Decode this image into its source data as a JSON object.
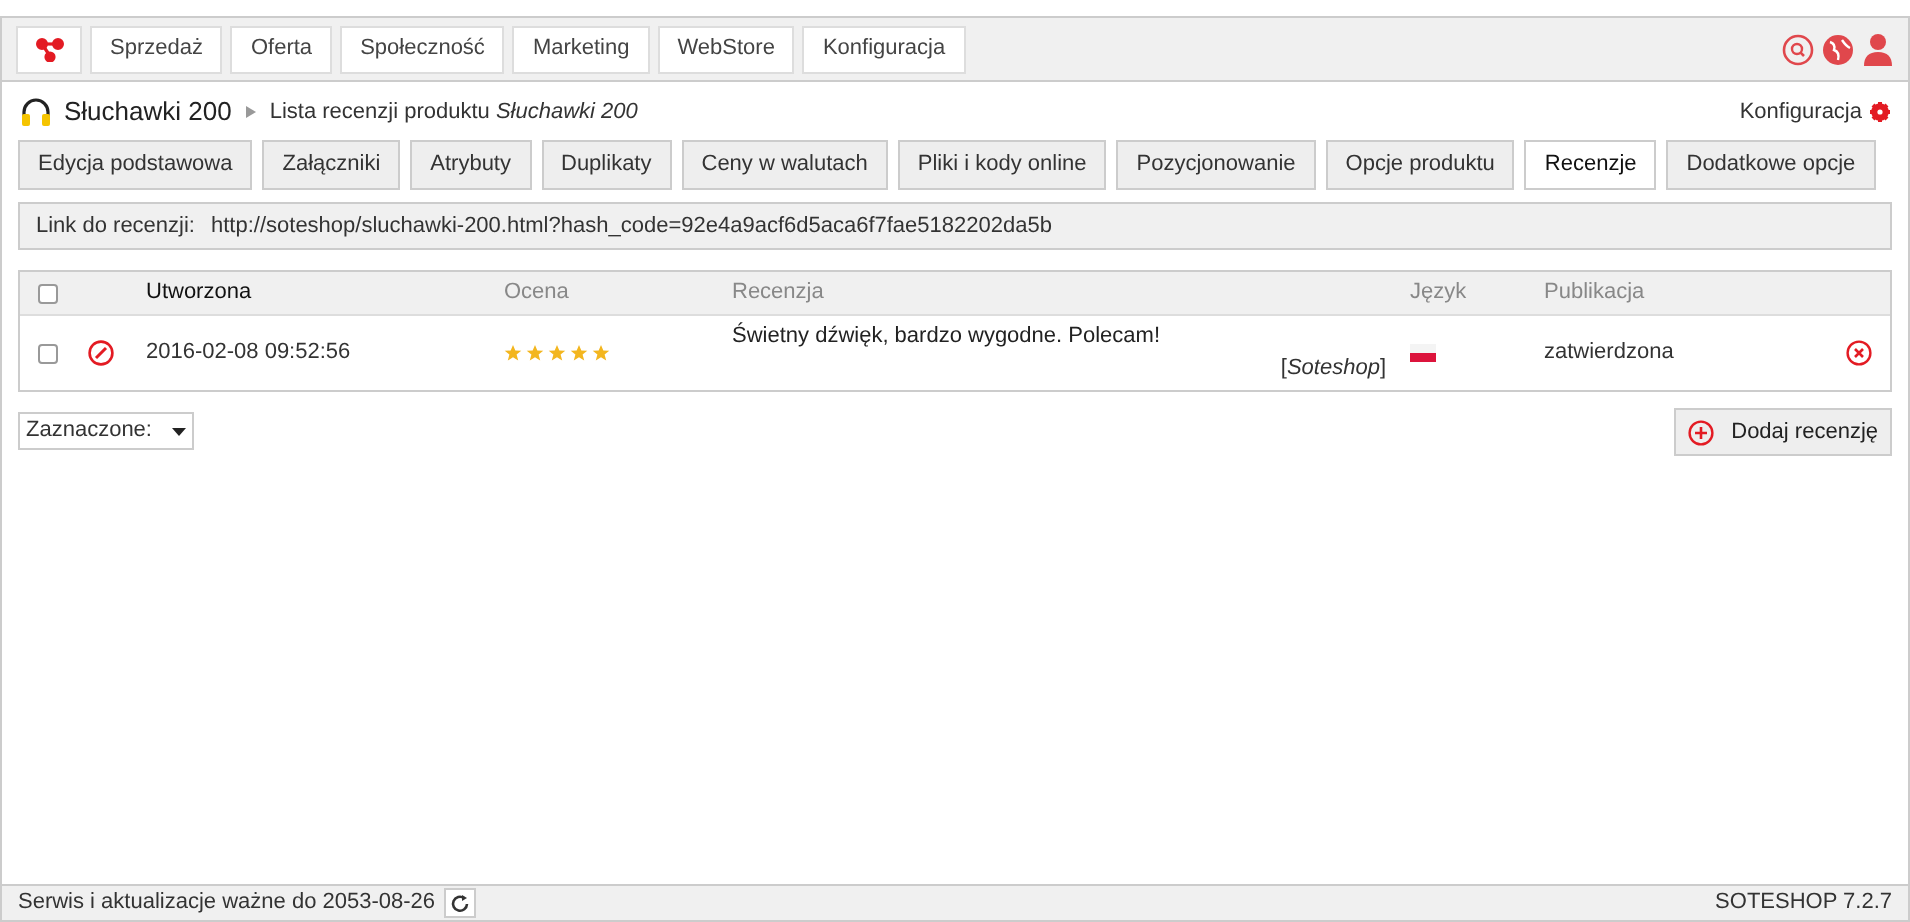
{
  "nav": [
    {
      "label": "Sprzedaż"
    },
    {
      "label": "Oferta"
    },
    {
      "label": "Społeczność"
    },
    {
      "label": "Marketing"
    },
    {
      "label": "WebStore"
    },
    {
      "label": "Konfiguracja"
    }
  ],
  "breadcrumb": {
    "product": "Słuchawki 200",
    "page": "Lista recenzji produktu *Słuchawki 200*"
  },
  "config_link": "Konfiguracja",
  "tabs": [
    {
      "label": "Edycja podstawowa",
      "selected": false
    },
    {
      "label": "Załączniki",
      "selected": false
    },
    {
      "label": "Atrybuty",
      "selected": false
    },
    {
      "label": "Duplikaty",
      "selected": false
    },
    {
      "label": "Ceny w walutach",
      "selected": false
    },
    {
      "label": "Pliki i kody online",
      "selected": false
    },
    {
      "label": "Pozycjonowanie",
      "selected": false
    },
    {
      "label": "Opcje produktu",
      "selected": false
    },
    {
      "label": "Recenzje",
      "selected": true
    },
    {
      "label": "Dodatkowe opcje",
      "selected": false
    }
  ],
  "review_link": {
    "label": "Link do recenzji:",
    "url": "http://soteshop/sluchawki-200.html?hash_code=92e4a9acf6d5aca6f7fae5182202da5b"
  },
  "table": {
    "select_all_checked": false,
    "columns": [
      "Utworzona",
      "Ocena",
      "Recenzja",
      "Język",
      "Publikacja"
    ],
    "rows": [
      {
        "checked": false,
        "created": "2016-02-08 09:52:56",
        "stars": 5,
        "review": "Świetny dźwięk, bardzo wygodne. Polecam!",
        "author": "[*Soteshop*]",
        "status": "zatwierdzona"
      }
    ]
  },
  "bulk_select": "Zaznaczone:",
  "add_button": "Dodaj recenzję",
  "footer": {
    "service": "Serwis i aktualizacje ważne do 2053-08-26",
    "version": "SOTESHOP 7.2.7"
  }
}
